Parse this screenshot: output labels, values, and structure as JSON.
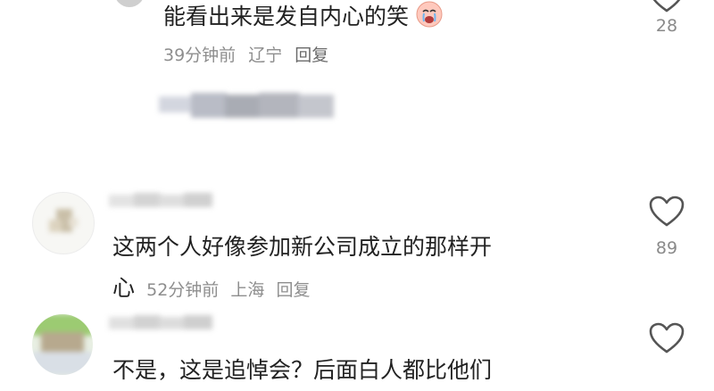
{
  "comments": [
    {
      "text": "能看出来是发自内心的笑",
      "emoji": "crying-face-icon",
      "time": "39分钟前",
      "location": "辽宁",
      "reply_label": "回复",
      "likes": "28"
    },
    {
      "text_line1": "这两个人好像参加新公司成立的那样开",
      "text_line2": "心",
      "time": "52分钟前",
      "location": "上海",
      "reply_label": "回复",
      "likes": "89"
    },
    {
      "text": "不是，这是追悼会？后面白人都比他们"
    }
  ],
  "colors": {
    "text": "#222222",
    "meta": "#8e8e8e",
    "icon": "#555555"
  }
}
